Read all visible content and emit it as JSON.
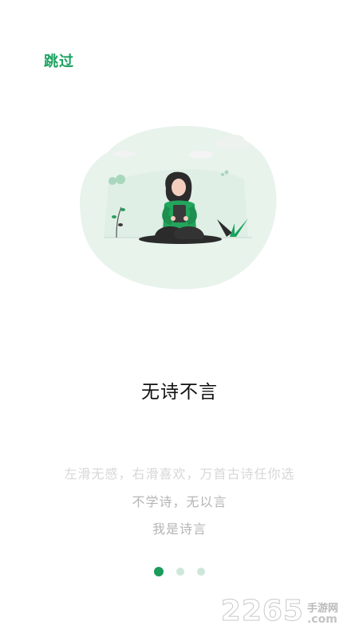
{
  "header": {
    "skip_label": "跳过"
  },
  "main": {
    "title": "无诗不言",
    "lines": [
      "左滑无感，右滑喜欢，万首古诗任你选",
      "不学诗，无以言",
      "我是诗言"
    ]
  },
  "pager": {
    "total": 3,
    "active": 1
  },
  "watermark": {
    "number": "2265",
    "cn": "手游网",
    "domain": ".com"
  },
  "colors": {
    "accent": "#1aa260",
    "bg_blob": "#e8f3ec"
  },
  "illustration": {
    "name": "woman-reading-phone-illustration"
  }
}
